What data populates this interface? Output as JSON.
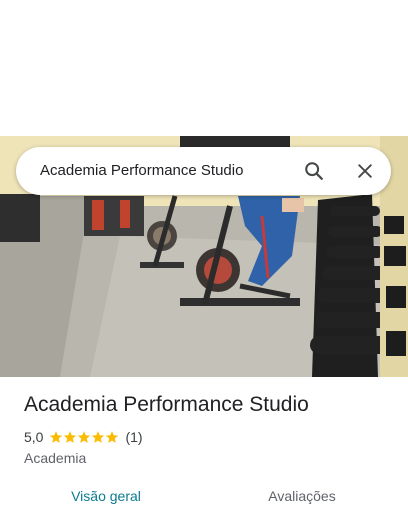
{
  "search": {
    "query": "Academia Performance Studio"
  },
  "place": {
    "name": "Academia Performance Studio",
    "rating": "5,0",
    "stars": 5,
    "review_count": "(1)",
    "category": "Academia"
  },
  "tabs": [
    {
      "label": "Visão geral",
      "active": true
    },
    {
      "label": "Avaliações",
      "active": false
    }
  ],
  "colors": {
    "accent": "#0b7b8f",
    "star": "#fbbc04",
    "text": "#202124",
    "secondary": "#5f6368"
  },
  "icons": {
    "search": "search-icon",
    "close": "close-icon",
    "star": "star-icon"
  }
}
